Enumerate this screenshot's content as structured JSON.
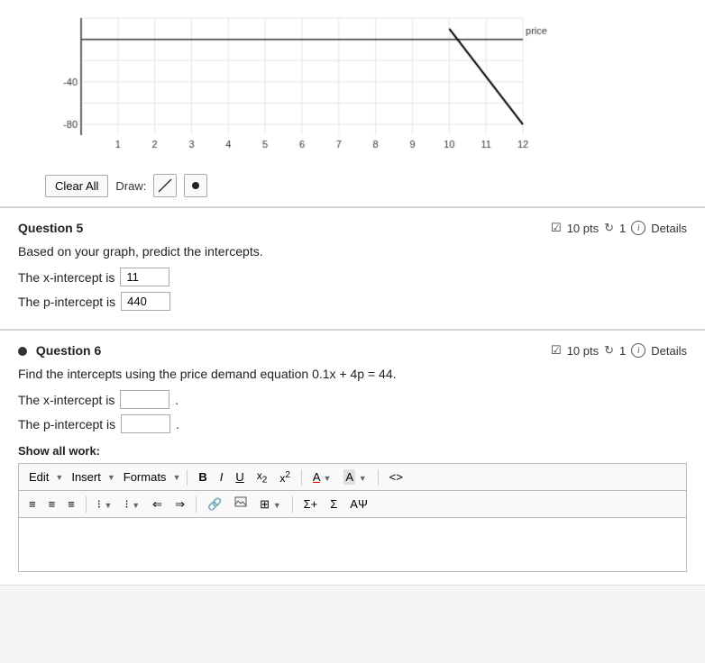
{
  "graph": {
    "yLabels": [
      "-80",
      "-40"
    ],
    "xLabel": "price",
    "xAxisValues": [
      "1",
      "2",
      "3",
      "4",
      "5",
      "6",
      "7",
      "8",
      "9",
      "10",
      "11",
      "12"
    ],
    "accentColor": "#000"
  },
  "controls": {
    "clearAllLabel": "Clear All",
    "drawLabel": "Draw:"
  },
  "question5": {
    "title": "Question 5",
    "pts": "10 pts",
    "retryCount": "1",
    "detailsLabel": "Details",
    "body": "Based on your graph, predict the intercepts.",
    "xInterceptLabel": "The x-intercept is",
    "xInterceptValue": "11",
    "pInterceptLabel": "The p-intercept is",
    "pInterceptValue": "440"
  },
  "question6": {
    "title": "Question 6",
    "pts": "10 pts",
    "retryCount": "1",
    "detailsLabel": "Details",
    "body": "Find the intercepts using the price demand equation 0.1x + 4p = 44.",
    "xInterceptLabel": "The x-intercept is",
    "xInterceptValue": "",
    "pInterceptLabel": "The p-intercept is",
    "pInterceptValue": "",
    "showAllWorkLabel": "Show all work:",
    "toolbar": {
      "editLabel": "Edit",
      "insertLabel": "Insert",
      "formatsLabel": "Formats",
      "boldLabel": "B",
      "italicLabel": "I",
      "underlineLabel": "U",
      "subLabel": "x₂",
      "supLabel": "x²",
      "fontColorLabel": "A",
      "highlightLabel": "A",
      "codeLabel": "<>",
      "alignLeft": "≡",
      "alignCenter": "≡",
      "alignRight": "≡",
      "bulletList": "≔",
      "numberedList": "≔",
      "indent1": "⇒",
      "indent2": "⇒",
      "linkLabel": "🔗",
      "imageLabel": "🖼",
      "tableLabel": "⊞",
      "sigmaLabel": "Σ+",
      "sumLabel": "Σ",
      "footerLabel": "Aψ"
    }
  }
}
